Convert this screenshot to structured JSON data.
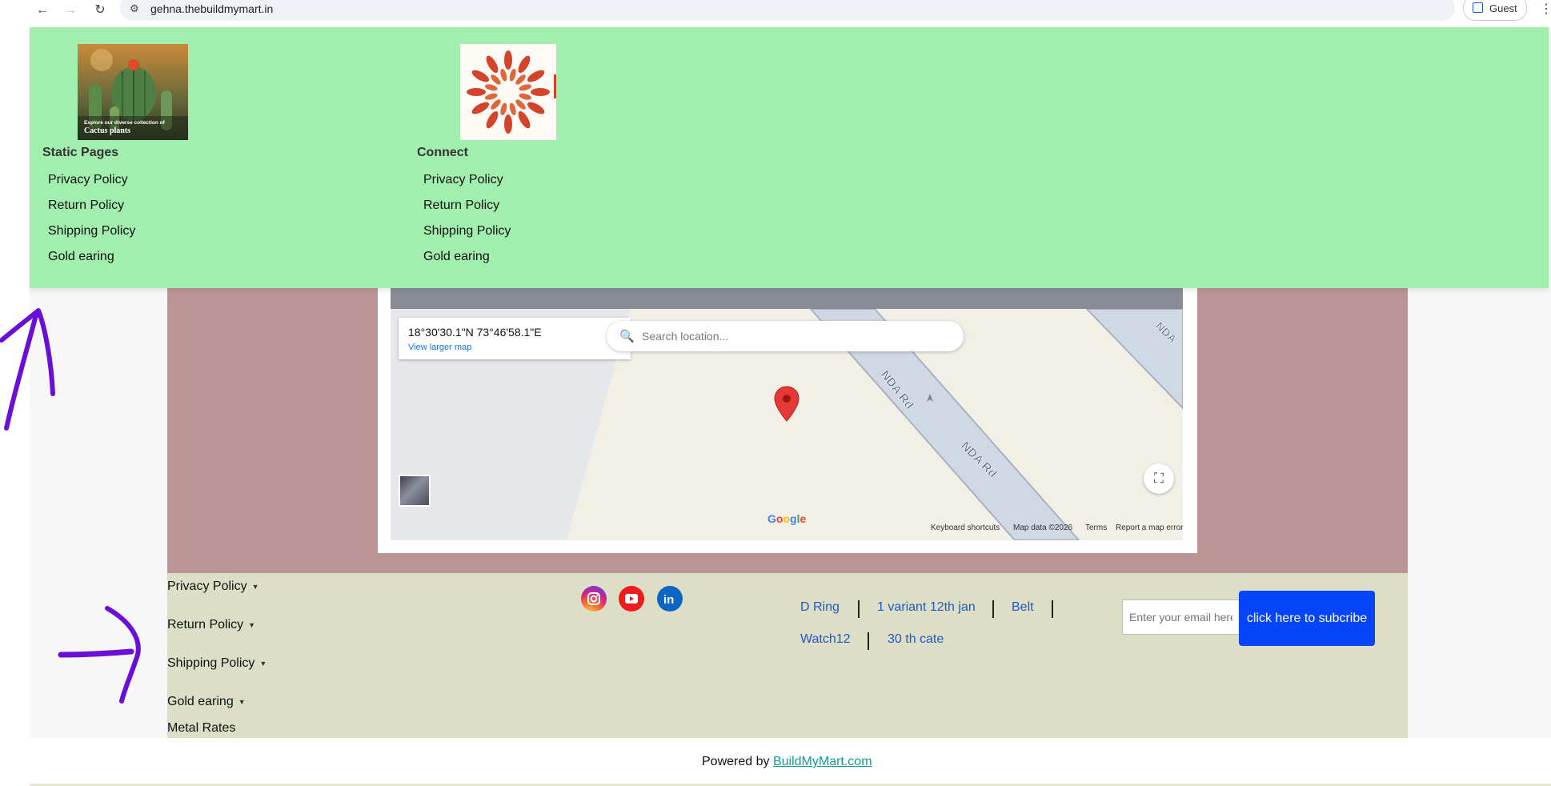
{
  "browser": {
    "url": "gehna.thebuildmymart.in",
    "profile_label": "Guest",
    "back_icon": "arrow-left-icon",
    "forward_icon": "arrow-right-icon",
    "reload_icon": "reload-icon"
  },
  "mega_menu": {
    "columns": [
      {
        "title": "Static Pages",
        "image_caption": [
          "Explore our diverse collection of",
          "Cactus plants"
        ],
        "links": [
          "Privacy Policy",
          "Return Policy",
          "Shipping Policy",
          "Gold earing"
        ]
      },
      {
        "title": "Connect",
        "links": [
          "Privacy Policy",
          "Return Policy",
          "Shipping Policy",
          "Gold earing"
        ]
      }
    ]
  },
  "map": {
    "coordinates": "18°30'30.1\"N 73°46'58.1\"E",
    "view_larger": "View larger map",
    "search_placeholder": "Search location...",
    "road_labels": [
      "NDA Rd",
      "NDA Rd",
      "NDA"
    ],
    "footer": {
      "google": "Google",
      "shortcuts": "Keyboard shortcuts",
      "map_data": "Map data ©2026",
      "terms": "Terms",
      "report": "Report a map error"
    }
  },
  "footer": {
    "dropdown_links": [
      "Privacy Policy",
      "Return Policy",
      "Shipping Policy",
      "Gold earing"
    ],
    "plain_link": "Metal Rates",
    "social": [
      "instagram-icon",
      "youtube-icon",
      "linkedin-icon"
    ],
    "tags_row1": [
      "D Ring",
      "1 variant 12th jan",
      "Belt"
    ],
    "tags_row2": [
      "Watch12",
      "30 th cate"
    ],
    "email_placeholder": "Enter your email here",
    "subscribe_label": "click here to subcribe"
  },
  "powered": {
    "prefix": "Powered by",
    "link": "BuildMyMart.com"
  },
  "colors": {
    "mega_menu_bg": "#a2eeae",
    "content_bg": "#bb9496",
    "footer_bg": "#dcdec5",
    "subscribe_bg": "#0645fb",
    "annotation": "#6a0fd6"
  }
}
